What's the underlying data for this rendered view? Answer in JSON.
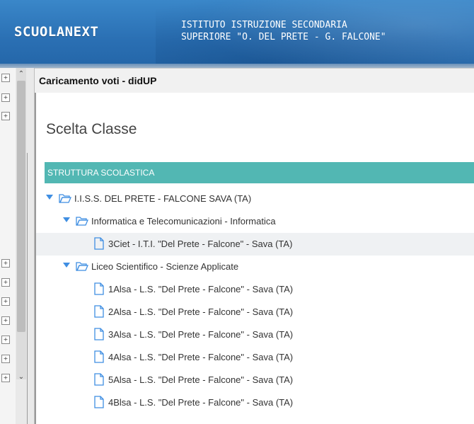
{
  "header": {
    "logo_text": "SCUOLANEXT",
    "school_line1": "ISTITUTO ISTRUZIONE SECONDARIA",
    "school_line2": "SUPERIORE \"O. DEL PRETE - G. FALCONE\""
  },
  "window": {
    "title": "Caricamento voti - didUP"
  },
  "page": {
    "heading": "Scelta Classe",
    "section_label": "STRUTTURA SCOLASTICA"
  },
  "tree": {
    "root": "I.I.S.S. DEL PRETE - FALCONE SAVA (TA)",
    "branches": [
      {
        "label": "Informatica e Telecomunicazioni - Informatica",
        "classes": [
          "3Ciet - I.T.I. \"Del Prete - Falcone\" - Sava (TA)"
        ]
      },
      {
        "label": "Liceo Scientifico - Scienze Applicate",
        "classes": [
          "1Alsa - L.S. \"Del Prete - Falcone\" - Sava (TA)",
          "2Alsa - L.S. \"Del Prete - Falcone\" - Sava (TA)",
          "3Alsa - L.S. \"Del Prete - Falcone\" - Sava (TA)",
          "4Alsa - L.S. \"Del Prete - Falcone\" - Sava (TA)",
          "5Alsa - L.S. \"Del Prete - Falcone\" - Sava (TA)",
          "4Blsa - L.S. \"Del Prete - Falcone\" - Sava (TA)"
        ]
      }
    ]
  },
  "colors": {
    "banner": "#2a6fb3",
    "section_bar": "#52b7b3",
    "tree_icon": "#3f8ee2",
    "selected_row": "#eff1f3"
  }
}
